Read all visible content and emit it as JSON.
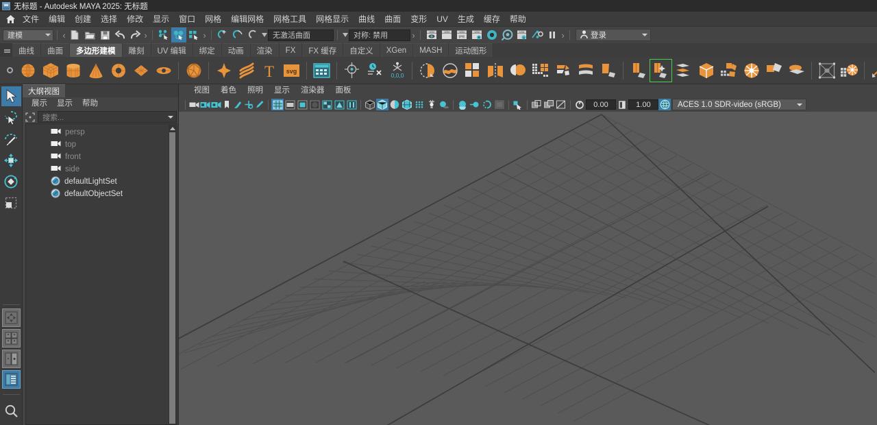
{
  "window": {
    "title": "无标题 - Autodesk MAYA 2025: 无标题",
    "icon": "maya-app-icon"
  },
  "menubar": {
    "home_icon": "home-icon",
    "items": [
      {
        "label": "文件"
      },
      {
        "label": "编辑"
      },
      {
        "label": "创建"
      },
      {
        "label": "选择"
      },
      {
        "label": "修改"
      },
      {
        "label": "显示"
      },
      {
        "label": "窗口"
      },
      {
        "label": "网格"
      },
      {
        "label": "编辑网格"
      },
      {
        "label": "网格工具"
      },
      {
        "label": "网格显示"
      },
      {
        "label": "曲线"
      },
      {
        "label": "曲面"
      },
      {
        "label": "变形"
      },
      {
        "label": "UV"
      },
      {
        "label": "生成"
      },
      {
        "label": "缓存"
      },
      {
        "label": "帮助"
      }
    ]
  },
  "statusline": {
    "menuset": "建模",
    "live_surface": "无激活曲面",
    "symmetry": "对称: 禁用",
    "login_label": "登录",
    "login_icon": "person-icon",
    "icons": [
      "new-scene-icon",
      "open-scene-icon",
      "save-scene-icon",
      "undo-icon",
      "redo-icon",
      "select-by-hierarchy-icon",
      "select-by-object-icon",
      "select-by-component-icon",
      "snap-to-grid-icon",
      "snap-to-curve-icon",
      "snap-to-point-icon",
      "render-current-frame-icon",
      "render-sequence-icon",
      "ipr-render-icon",
      "render-settings-icon",
      "hypershade-icon",
      "render-view-icon",
      "rendering-flags-icon",
      "toggle-playback-icon",
      "pause-icon"
    ]
  },
  "shelf": {
    "grip_icon": "shelf-grip-icon",
    "tabs": [
      {
        "label": "曲线",
        "active": false
      },
      {
        "label": "曲面",
        "active": false
      },
      {
        "label": "多边形建模",
        "active": true
      },
      {
        "label": "雕刻",
        "active": false
      },
      {
        "label": "UV 编辑",
        "active": false
      },
      {
        "label": "绑定",
        "active": false
      },
      {
        "label": "动画",
        "active": false
      },
      {
        "label": "渲染",
        "active": false
      },
      {
        "label": "FX",
        "active": false
      },
      {
        "label": "FX 缓存",
        "active": false
      },
      {
        "label": "自定义",
        "active": false
      },
      {
        "label": "XGen",
        "active": false
      },
      {
        "label": "MASH",
        "active": false
      },
      {
        "label": "运动图形",
        "active": false
      }
    ],
    "icons": [
      "poly-sphere-icon",
      "poly-cube-icon",
      "poly-cylinder-icon",
      "poly-cone-icon",
      "poly-torus-icon",
      "poly-plane-icon",
      "poly-disc-icon",
      "poly-platonic-icon",
      "poly-soup-icon",
      "poly-helix-icon",
      "poly-type-icon",
      "poly-svg-icon",
      "poly-spreadsheet-icon",
      "center-pivot-icon",
      "freeze-transform-icon",
      "reset-transform-icon",
      "combine-icon",
      "smooth-icon",
      "extrude-icon",
      "mirror-icon",
      "boolean-icon",
      "multi-cut-icon",
      "bevel-icon",
      "bridge-icon",
      "append-polygon-icon",
      "insert-edge-loop-icon",
      "offset-edge-loop-icon",
      "poly-reduce-icon",
      "quadrangulate-icon",
      "triangulate-icon",
      "crease-icon",
      "smooth-mesh-preview-icon",
      "sculpt-icon",
      "wedge-icon",
      "poke-icon",
      "connect-icon",
      "detach-icon",
      "slide-edge-icon"
    ],
    "selected_icon_index": 25
  },
  "toolbox": {
    "tools": [
      {
        "icon": "select-tool-icon",
        "active": true
      },
      {
        "icon": "lasso-select-tool-icon",
        "active": false
      },
      {
        "icon": "paint-select-tool-icon",
        "active": false
      },
      {
        "icon": "move-tool-icon",
        "active": false
      },
      {
        "icon": "rotate-tool-icon",
        "active": false
      },
      {
        "icon": "scale-tool-icon",
        "active": false
      }
    ],
    "layouts": [
      {
        "icon": "layout-single-pane-icon",
        "active": false
      },
      {
        "icon": "layout-four-pane-icon",
        "active": false
      },
      {
        "icon": "layout-two-pane-icon",
        "active": false
      },
      {
        "icon": "layout-persp-outliner-icon",
        "active": true
      }
    ],
    "search_icon": "search-icon"
  },
  "outliner": {
    "tab_label": "大纲视图",
    "menus": [
      {
        "label": "展示"
      },
      {
        "label": "显示"
      },
      {
        "label": "帮助"
      }
    ],
    "search_placeholder": "搜索...",
    "search_value": "",
    "select_icon": "selection-mask-icon",
    "items": [
      {
        "name": "persp",
        "icon": "camera-icon",
        "dim": true
      },
      {
        "name": "top",
        "icon": "camera-icon",
        "dim": true
      },
      {
        "name": "front",
        "icon": "camera-icon",
        "dim": true
      },
      {
        "name": "side",
        "icon": "camera-icon",
        "dim": true
      },
      {
        "name": "defaultLightSet",
        "icon": "set-icon",
        "dim": false
      },
      {
        "name": "defaultObjectSet",
        "icon": "set-icon",
        "dim": false
      }
    ]
  },
  "viewport": {
    "menus": [
      {
        "label": "视图"
      },
      {
        "label": "着色"
      },
      {
        "label": "照明"
      },
      {
        "label": "显示"
      },
      {
        "label": "渲染器"
      },
      {
        "label": "面板"
      }
    ],
    "exposure": "0.00",
    "gamma": "1.00",
    "color_management": "ACES 1.0 SDR-video (sRGB)",
    "cm_toggle_icon": "color-management-icon",
    "exposure_icon": "exposure-icon",
    "gamma_icon": "gamma-icon",
    "bar_icons": [
      "select-camera-icon",
      "camera-attributes-icon",
      "bookmark-camera-icon",
      "image-plane-icon",
      "two-d-pan-zoom-icon",
      "grease-pencil-icon",
      "toggle-grid-icon",
      "toggle-film-gate-icon",
      "toggle-resolution-gate-icon",
      "toggle-gate-mask-icon",
      "toggle-field-chart-icon",
      "toggle-safe-action-icon",
      "toggle-safe-title-icon",
      "wireframe-shaded-icon",
      "smooth-shade-all-icon",
      "shade-flat-icon",
      "wireframe-on-shaded-icon",
      "texture-icon",
      "use-all-lights-icon",
      "shadows-icon",
      "screen-space-ao-icon",
      "motion-blur-icon",
      "multisample-aa-icon",
      "depth-of-field-icon",
      "isolate-select-icon",
      "xray-icon",
      "xray-joints-icon",
      "xray-active-components-icon"
    ],
    "active_bar_icons": [
      "toggle-grid-icon",
      "smooth-shade-all-icon",
      "color-management-icon"
    ]
  },
  "colors": {
    "background": "#444444",
    "viewport_bg": "#5a5a5a",
    "grid_line": "#4b4b4b",
    "grid_axis": "#3c3c3c",
    "accent_blue": "#3d7ca8",
    "shelf_orange": "#e8943c",
    "shelf_cyan": "#3fb6c4",
    "titlebar": "#2b2b2b",
    "selection_green": "#44d04a"
  }
}
